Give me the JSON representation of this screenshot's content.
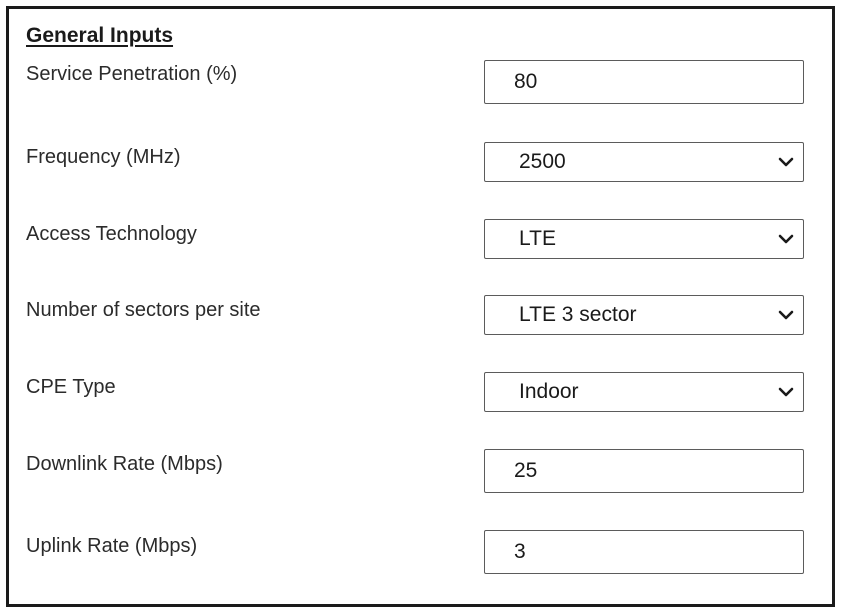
{
  "section": {
    "title": "General Inputs"
  },
  "fields": [
    {
      "label": "Service Penetration (%)",
      "type": "text",
      "value": "80"
    },
    {
      "label": "Frequency (MHz)",
      "type": "select",
      "value": "2500",
      "icon": "chevron-down-icon"
    },
    {
      "label": "Access Technology",
      "type": "select",
      "value": "LTE",
      "icon": "chevron-down-icon"
    },
    {
      "label": "Number of sectors per site",
      "type": "select",
      "value": "LTE 3 sector",
      "icon": "chevron-down-icon"
    },
    {
      "label": "CPE Type",
      "type": "select",
      "value": "Indoor",
      "icon": "chevron-down-icon"
    },
    {
      "label": "Downlink Rate (Mbps)",
      "type": "text",
      "value": "25"
    },
    {
      "label": "Uplink Rate (Mbps)",
      "type": "text",
      "value": "3"
    }
  ]
}
